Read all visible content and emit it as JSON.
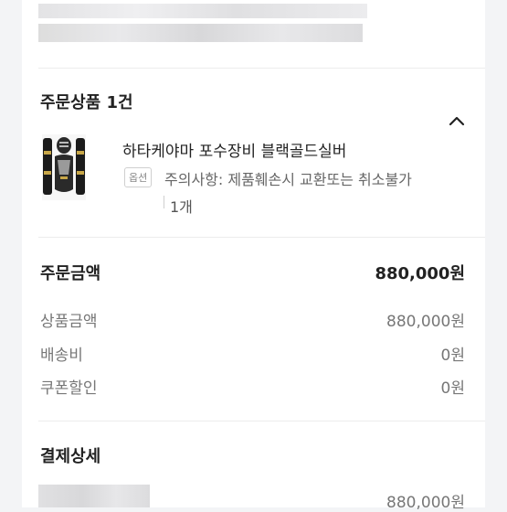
{
  "order_items": {
    "title": "주문상품 1건",
    "product": {
      "name": "하타케야마 포수장비 블랙골드실버",
      "option_badge": "옵션",
      "option_text": "주의사항: 제품훼손시 교환또는 취소불가",
      "quantity": "1개"
    }
  },
  "summary": {
    "title": "주문금액",
    "total": "880,000원",
    "rows": [
      {
        "label": "상품금액",
        "value": "880,000원"
      },
      {
        "label": "배송비",
        "value": "0원"
      },
      {
        "label": "쿠폰할인",
        "value": "0원"
      }
    ]
  },
  "payment": {
    "title": "결제상세",
    "amount": "880,000원"
  }
}
